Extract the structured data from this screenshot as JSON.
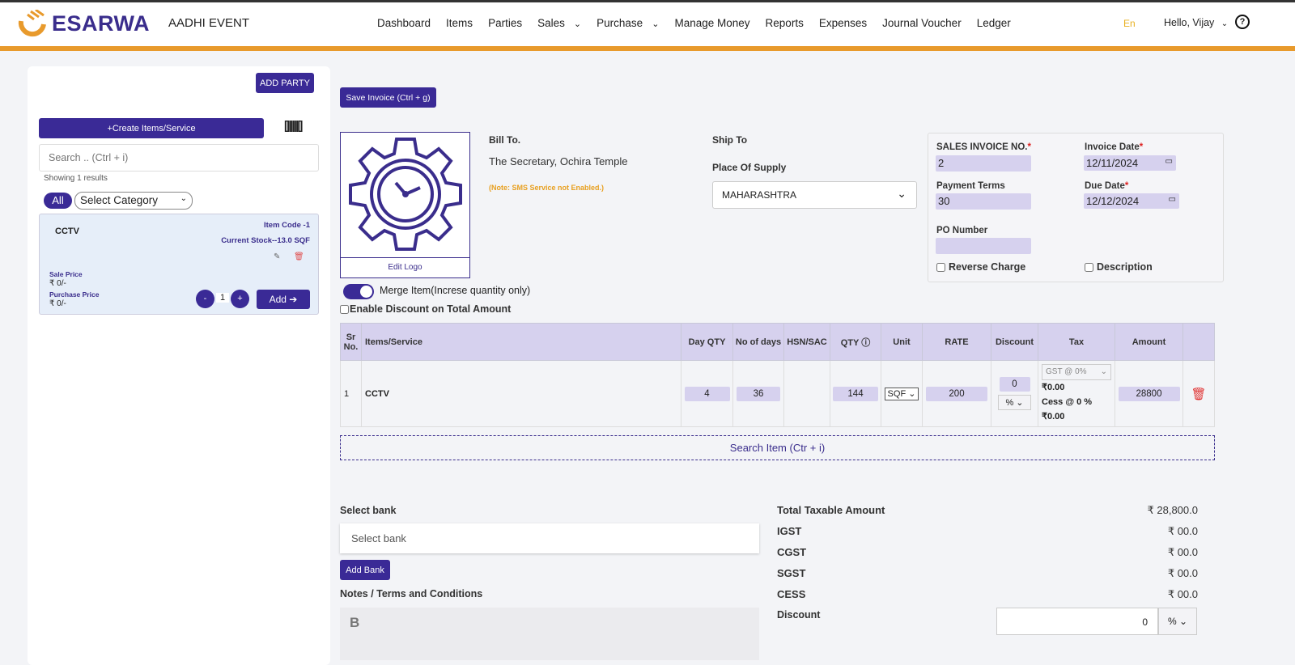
{
  "header": {
    "brand": "ESARWA",
    "company": "AADHI EVENT",
    "nav": [
      "Dashboard",
      "Items",
      "Parties",
      "Sales",
      "Purchase",
      "Manage Money",
      "Reports",
      "Expenses",
      "Journal Voucher",
      "Ledger"
    ],
    "lang": "En",
    "greeting": "Hello, Vijay"
  },
  "sidebar": {
    "add_party": "ADD PARTY",
    "create_item": "+Create Items/Service",
    "search_placeholder": "Search .. (Ctrl + i)",
    "results": "Showing 1 results",
    "all": "All",
    "category": "Select Category",
    "item": {
      "name": "CCTV",
      "code": "Item Code -1",
      "stock": "Current Stock--13.0 SQF",
      "sale_label": "Sale Price",
      "sale": "₹ 0/-",
      "purchase_label": "Purchase Price",
      "purchase": "₹ 0/-",
      "qty": "1",
      "minus": "-",
      "plus": "+",
      "add": "Add ➔"
    }
  },
  "invoice": {
    "save": "Save Invoice (Ctrl + g)",
    "edit_logo": "Edit Logo",
    "bill_to": "Bill To.",
    "bill_name": "The Secretary, Ochira Temple",
    "sms_note": "(Note: SMS Service not Enabled.)",
    "ship_to": "Ship To",
    "place_label": "Place Of Supply",
    "place": "MAHARASHTRA",
    "no_label": "SALES INVOICE NO.",
    "no": "2",
    "date_label": "Invoice Date",
    "date": "12/11/2024",
    "terms_label": "Payment Terms",
    "terms": "30",
    "due_label": "Due Date",
    "due": "12/12/2024",
    "po_label": "PO Number",
    "po": "",
    "reverse": "Reverse Charge",
    "description": "Description",
    "merge": "Merge Item(Increse quantity only)",
    "enable_discount": "Enable Discount on Total Amount"
  },
  "table": {
    "headers": [
      "Sr No.",
      "Items/Service",
      "Day QTY",
      "No of days",
      "HSN/SAC",
      "QTY",
      "Unit",
      "RATE",
      "Discount",
      "Tax",
      "Amount"
    ],
    "row": {
      "sr": "1",
      "item": "CCTV",
      "day_qty": "4",
      "days": "36",
      "hsn": "",
      "qty": "144",
      "unit": "SQF",
      "rate": "200",
      "discount": "0",
      "disc_type": "%",
      "gst": "GST @ 0%",
      "gst_amt": "₹0.00",
      "cess": "Cess @ 0 %",
      "cess_amt": "₹0.00",
      "amount": "28800"
    },
    "search": "Search Item (Ctr + i)"
  },
  "bank": {
    "label": "Select bank",
    "placeholder": "Select bank",
    "add": "Add Bank",
    "notes": "Notes / Terms and Conditions",
    "bold": "B"
  },
  "totals": {
    "taxable_label": "Total Taxable Amount",
    "taxable": "₹ 28,800.0",
    "igst_label": "IGST",
    "igst": "₹ 00.0",
    "cgst_label": "CGST",
    "cgst": "₹ 00.0",
    "sgst_label": "SGST",
    "sgst": "₹ 00.0",
    "cess_label": "CESS",
    "cess": "₹ 00.0",
    "discount_label": "Discount",
    "discount": "0",
    "discount_type": "%"
  }
}
